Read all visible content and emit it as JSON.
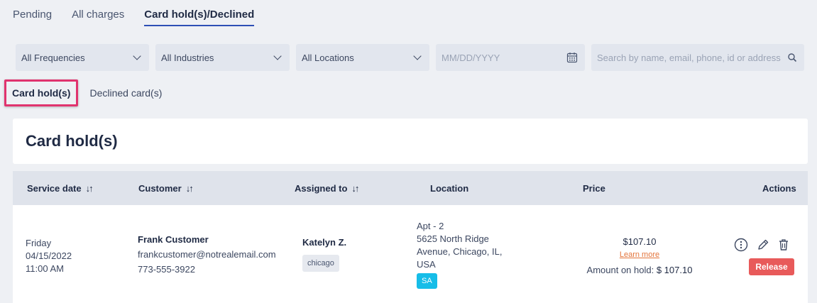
{
  "top_tabs": [
    "Pending",
    "All charges",
    "Card hold(s)/Declined"
  ],
  "filters": {
    "frequency": "All Frequencies",
    "industry": "All Industries",
    "location": "All Locations",
    "date_placeholder": "MM/DD/YYYY",
    "search_placeholder": "Search by name, email, phone, id or address"
  },
  "sub_tabs": [
    "Card hold(s)",
    "Declined card(s)"
  ],
  "section_title": "Card hold(s)",
  "columns": [
    "Service date",
    "Customer",
    "Assigned to",
    "Location",
    "Price",
    "Actions"
  ],
  "row": {
    "day": "Friday",
    "date": "04/15/2022",
    "time": "11:00 AM",
    "customer_name": "Frank Customer",
    "customer_email": "frankcustomer@notrealemail.com",
    "customer_phone": "773-555-3922",
    "assignee": "Katelyn Z.",
    "assignee_tag": "chicago",
    "location_lines": [
      "Apt - 2",
      "5625 North Ridge",
      "Avenue, Chicago, IL,",
      "USA"
    ],
    "location_badge": "SA",
    "price": "$107.10",
    "learn_more": "Learn more",
    "hold_label": "Amount on hold:",
    "hold_amount": "$ 107.10",
    "release_label": "Release"
  },
  "colors": {
    "accent": "#2d4fb5",
    "highlight": "#e0336e",
    "release": "#e85a5a",
    "badge": "#16bde8",
    "link": "#e3743b"
  }
}
